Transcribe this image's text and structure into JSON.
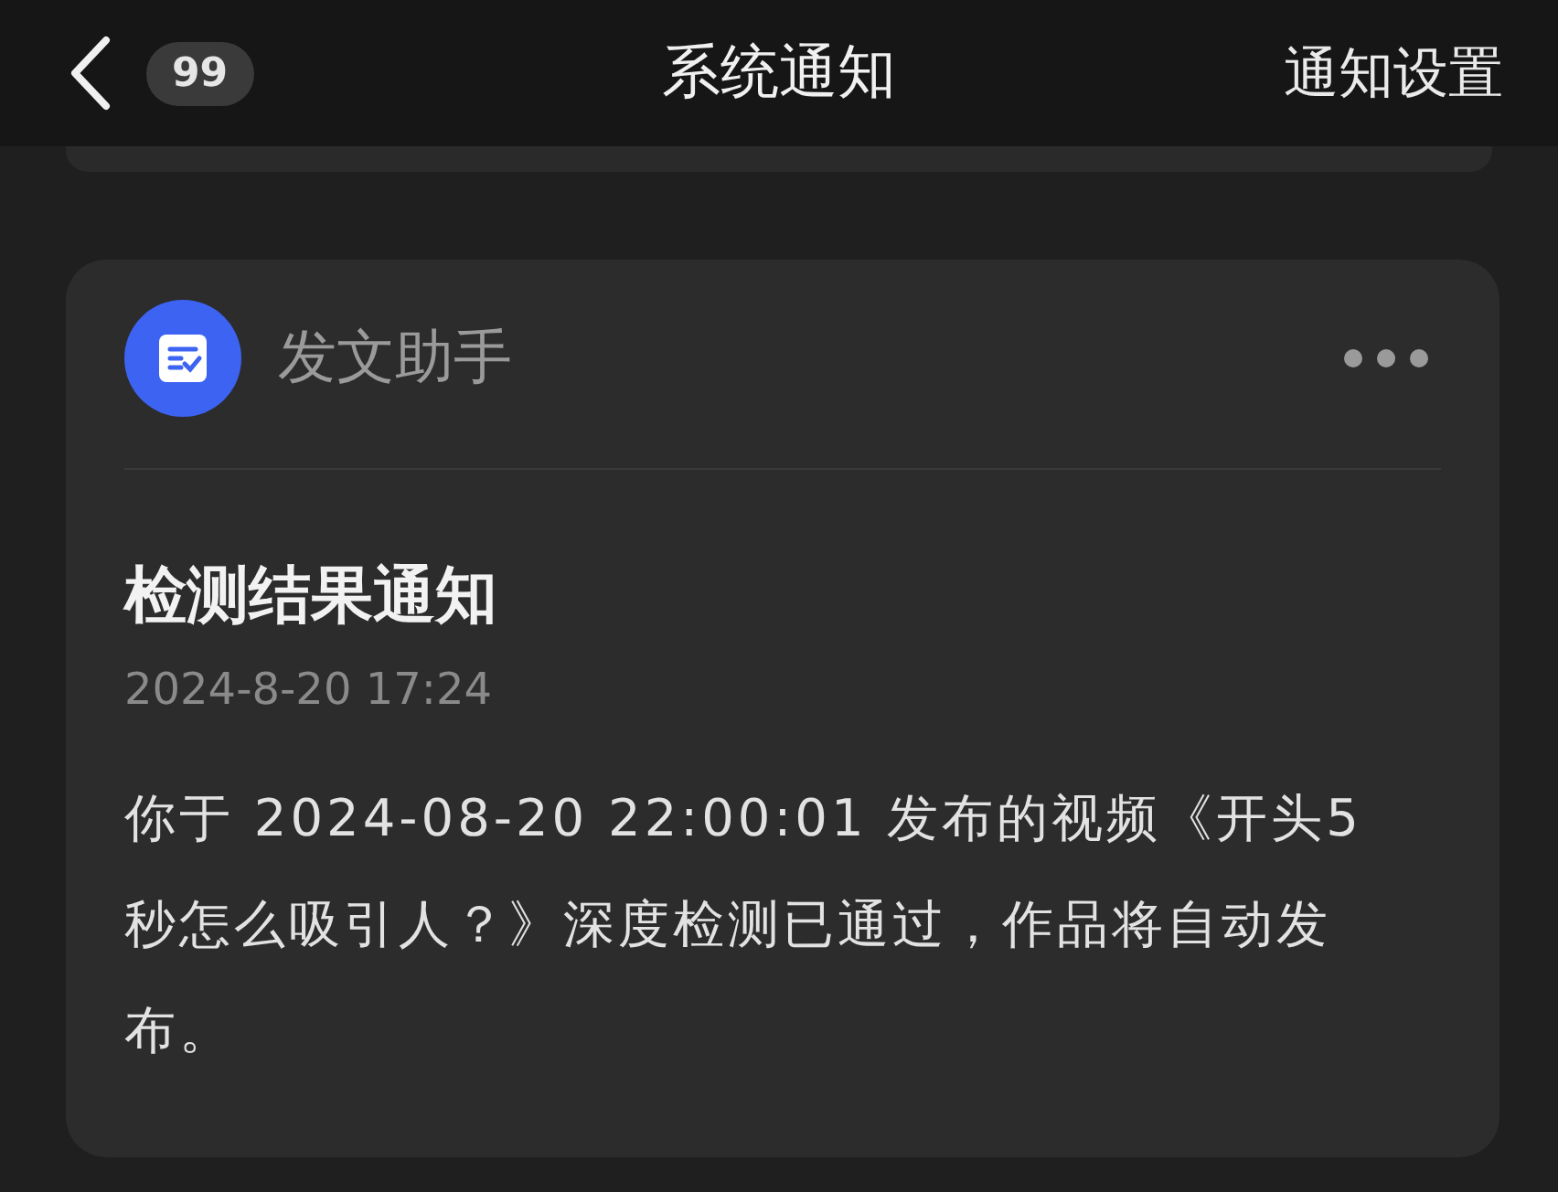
{
  "header": {
    "back_count": "99",
    "title": "系统通知",
    "settings_link": "通知设置"
  },
  "notification": {
    "sender": "发文助手",
    "title": "检测结果通知",
    "time": "2024-8-20 17:24",
    "body": "你于 2024-08-20 22:00:01 发布的视频《开头5秒怎么吸引人？》深度检测已通过，作品将自动发布。"
  }
}
